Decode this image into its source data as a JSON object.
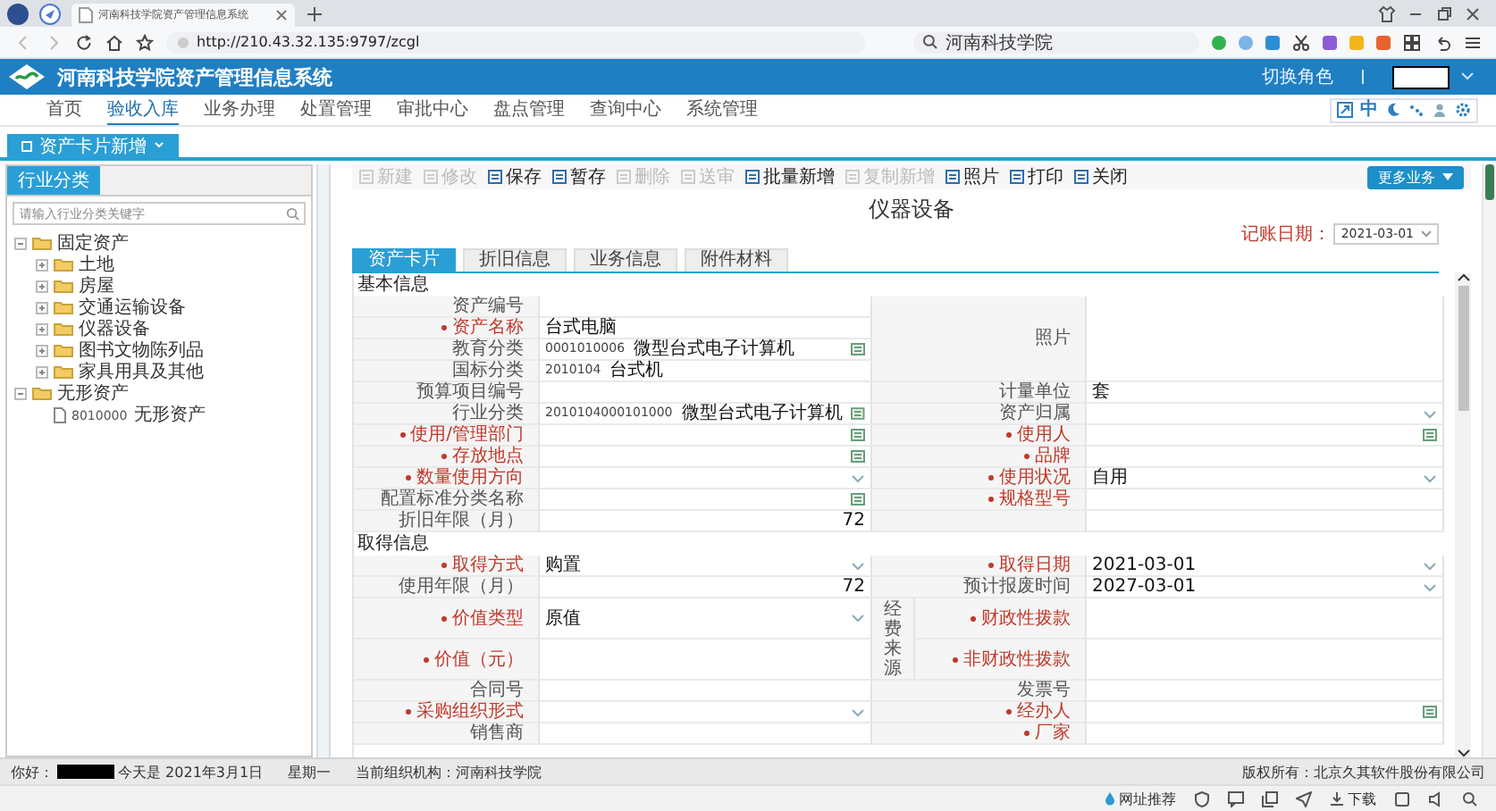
{
  "browser": {
    "tab_title": "河南科技学院资产管理信息系统",
    "url": "http://210.43.32.135:9797/zcgl",
    "search_text": "河南科技学院"
  },
  "header": {
    "title": "河南科技学院资产管理信息系统",
    "switch_role": "切换角色",
    "lang_toggle": "中"
  },
  "nav": [
    {
      "label": "首页",
      "selected": false
    },
    {
      "label": "验收入库",
      "selected": true
    },
    {
      "label": "业务办理",
      "selected": false
    },
    {
      "label": "处置管理",
      "selected": false
    },
    {
      "label": "审批中心",
      "selected": false
    },
    {
      "label": "盘点管理",
      "selected": false
    },
    {
      "label": "查询中心",
      "selected": false
    },
    {
      "label": "系统管理",
      "selected": false
    }
  ],
  "page_tabs": [
    {
      "label": "资产卡片新增",
      "selected": true
    }
  ],
  "left_panel": {
    "tabs": [
      {
        "label": "行业分类",
        "selected": true
      }
    ],
    "search": {
      "placeholder": "请输入行业分类关键字"
    },
    "tree": [
      {
        "label": "固定资产",
        "kind": "folder",
        "expanded": true,
        "children": [
          {
            "label": "土地",
            "kind": "folder",
            "expanded": false
          },
          {
            "label": "房屋",
            "kind": "folder",
            "expanded": false
          },
          {
            "label": "交通运输设备",
            "kind": "folder",
            "expanded": false
          },
          {
            "label": "仪器设备",
            "kind": "folder",
            "expanded": false
          },
          {
            "label": "图书文物陈列品",
            "kind": "folder",
            "expanded": false
          },
          {
            "label": "家具用具及其他",
            "kind": "folder",
            "expanded": false
          }
        ]
      },
      {
        "label": "无形资产",
        "kind": "folder",
        "expanded": true,
        "children": [
          {
            "label": "无形资产",
            "code": "8010000",
            "kind": "file"
          }
        ]
      }
    ]
  },
  "toolbar": {
    "buttons": [
      {
        "label": "新建",
        "disabled": true
      },
      {
        "label": "修改",
        "disabled": true
      },
      {
        "label": "保存",
        "disabled": false
      },
      {
        "label": "暂存",
        "disabled": false
      },
      {
        "label": "删除",
        "disabled": true
      },
      {
        "label": "送审",
        "disabled": true
      },
      {
        "label": "批量新增",
        "disabled": false
      },
      {
        "label": "复制新增",
        "disabled": true
      },
      {
        "label": "照片",
        "disabled": false
      },
      {
        "label": "打印",
        "disabled": false
      },
      {
        "label": "关闭",
        "disabled": false
      }
    ],
    "more_button": "更多业务"
  },
  "form": {
    "title": "仪器设备",
    "record_date": {
      "label": "记账日期：",
      "value": "2021-03-01"
    },
    "tabs": [
      {
        "label": "资产卡片",
        "selected": true
      },
      {
        "label": "折旧信息",
        "selected": false
      },
      {
        "label": "业务信息",
        "selected": false
      },
      {
        "label": "附件材料",
        "selected": false
      }
    ],
    "sections": [
      {
        "title": "基本信息",
        "rows": [
          {
            "left": {
              "label": "资产编号",
              "required": false
            },
            "right": {
              "kind": "photo",
              "label": "照片"
            }
          },
          {
            "left": {
              "label": "资产名称",
              "required": true,
              "kind": "text",
              "value": "台式电脑"
            },
            "right": null
          },
          {
            "left": {
              "label": "教育分类",
              "required": false,
              "kind": "picker",
              "code": "0001010006",
              "value": "微型台式电子计算机"
            },
            "right": null
          },
          {
            "left": {
              "label": "国标分类",
              "required": false,
              "kind": "text",
              "code": "2010104",
              "value": "台式机"
            },
            "right": null
          },
          {
            "left": {
              "label": "预算项目编号",
              "required": false
            },
            "right": {
              "label": "计量单位",
              "required": false,
              "kind": "text",
              "value": "套"
            }
          },
          {
            "left": {
              "label": "行业分类",
              "required": false,
              "kind": "picker",
              "code": "2010104000101000",
              "value": "微型台式电子计算机"
            },
            "right": {
              "label": "资产归属",
              "required": false,
              "kind": "select"
            }
          },
          {
            "left": {
              "label": "使用/管理部门",
              "required": true,
              "kind": "picker"
            },
            "right": {
              "label": "使用人",
              "required": true,
              "kind": "picker"
            }
          },
          {
            "left": {
              "label": "存放地点",
              "required": true,
              "kind": "picker"
            },
            "right": {
              "label": "品牌",
              "required": true
            }
          },
          {
            "left": {
              "label": "数量使用方向",
              "required": true,
              "kind": "select"
            },
            "right": {
              "label": "使用状况",
              "required": true,
              "kind": "select",
              "value": "自用"
            }
          },
          {
            "left": {
              "label": "配置标准分类名称",
              "required": false,
              "kind": "picker"
            },
            "right": {
              "label": "规格型号",
              "required": true
            }
          },
          {
            "left": {
              "label": "折旧年限（月）",
              "required": false,
              "kind": "number",
              "value": "72"
            },
            "right": {
              "kind": "empty"
            }
          }
        ]
      },
      {
        "title": "取得信息",
        "rows": [
          {
            "left": {
              "label": "取得方式",
              "required": true,
              "kind": "select",
              "value": "购置"
            },
            "right": {
              "label": "取得日期",
              "required": true,
              "kind": "select",
              "value": "2021-03-01"
            }
          },
          {
            "left": {
              "label": "使用年限（月）",
              "required": false,
              "kind": "number",
              "value": "72"
            },
            "right": {
              "label": "预计报废时间",
              "required": false,
              "kind": "select",
              "value": "2027-03-01"
            }
          },
          {
            "group": "经费来源",
            "rows": [
              {
                "left": {
                  "label": "价值类型",
                  "required": true,
                  "kind": "select",
                  "value": "原值"
                },
                "right": {
                  "label": "财政性拨款",
                  "required": true
                }
              },
              {
                "left": {
                  "label": "价值（元）",
                  "required": true
                },
                "right": {
                  "label": "非财政性拨款",
                  "required": true
                }
              }
            ]
          },
          {
            "left": {
              "label": "合同号",
              "required": false
            },
            "right": {
              "label": "发票号",
              "required": false
            }
          },
          {
            "left": {
              "label": "采购组织形式",
              "required": true,
              "kind": "select"
            },
            "right": {
              "label": "经办人",
              "required": true,
              "kind": "picker"
            }
          },
          {
            "left": {
              "label": "销售商",
              "required": false
            },
            "right": {
              "label": "厂家",
              "required": true
            }
          }
        ]
      }
    ]
  },
  "status_bar": {
    "greeting": "你好：",
    "date_text": "今天是 2021年3月1日",
    "weekday": "星期一",
    "org": "当前组织机构：河南科技学院",
    "copyright": "版权所有：北京久其软件股份有限公司"
  },
  "browser_bottom": {
    "recommend": "网址推荐",
    "download": "下载"
  }
}
